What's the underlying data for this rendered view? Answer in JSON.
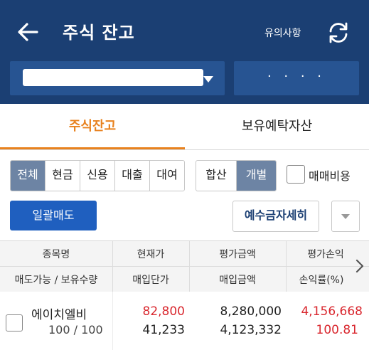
{
  "header": {
    "title": "주식 잔고",
    "notice_label": "유의사항"
  },
  "account": {
    "password_mask": "· · · ·"
  },
  "tabs": [
    {
      "label": "주식잔고",
      "active": true
    },
    {
      "label": "보유예탁자산",
      "active": false
    }
  ],
  "filters": {
    "type_options": [
      "전체",
      "현금",
      "신용",
      "대출",
      "대여"
    ],
    "type_selected": "전체",
    "view_options": [
      "합산",
      "개별"
    ],
    "view_selected": "개별",
    "trading_fee_label": "매매비용",
    "trading_fee_checked": false
  },
  "actions": {
    "bulk_sell_label": "일괄매도",
    "deposit_detail_label": "예수금자세히"
  },
  "table": {
    "header_row1": [
      "종목명",
      "현재가",
      "평가금액",
      "평가손익"
    ],
    "header_row2": [
      "매도가능 / 보유수량",
      "매입단가",
      "매입금액",
      "손익률(%)"
    ],
    "rows": [
      {
        "name": "에이치엘비",
        "quantity": "100 / 100",
        "current_price": "82,800",
        "purchase_price": "41,233",
        "eval_amount": "8,280,000",
        "purchase_amount": "4,123,332",
        "eval_pl": "4,156,668",
        "return_rate": "100.81"
      }
    ]
  },
  "colors": {
    "header_bg": "#1b3f73",
    "accent": "#e8821f",
    "primary_button": "#1f5fbf",
    "profit": "#d9272e"
  }
}
